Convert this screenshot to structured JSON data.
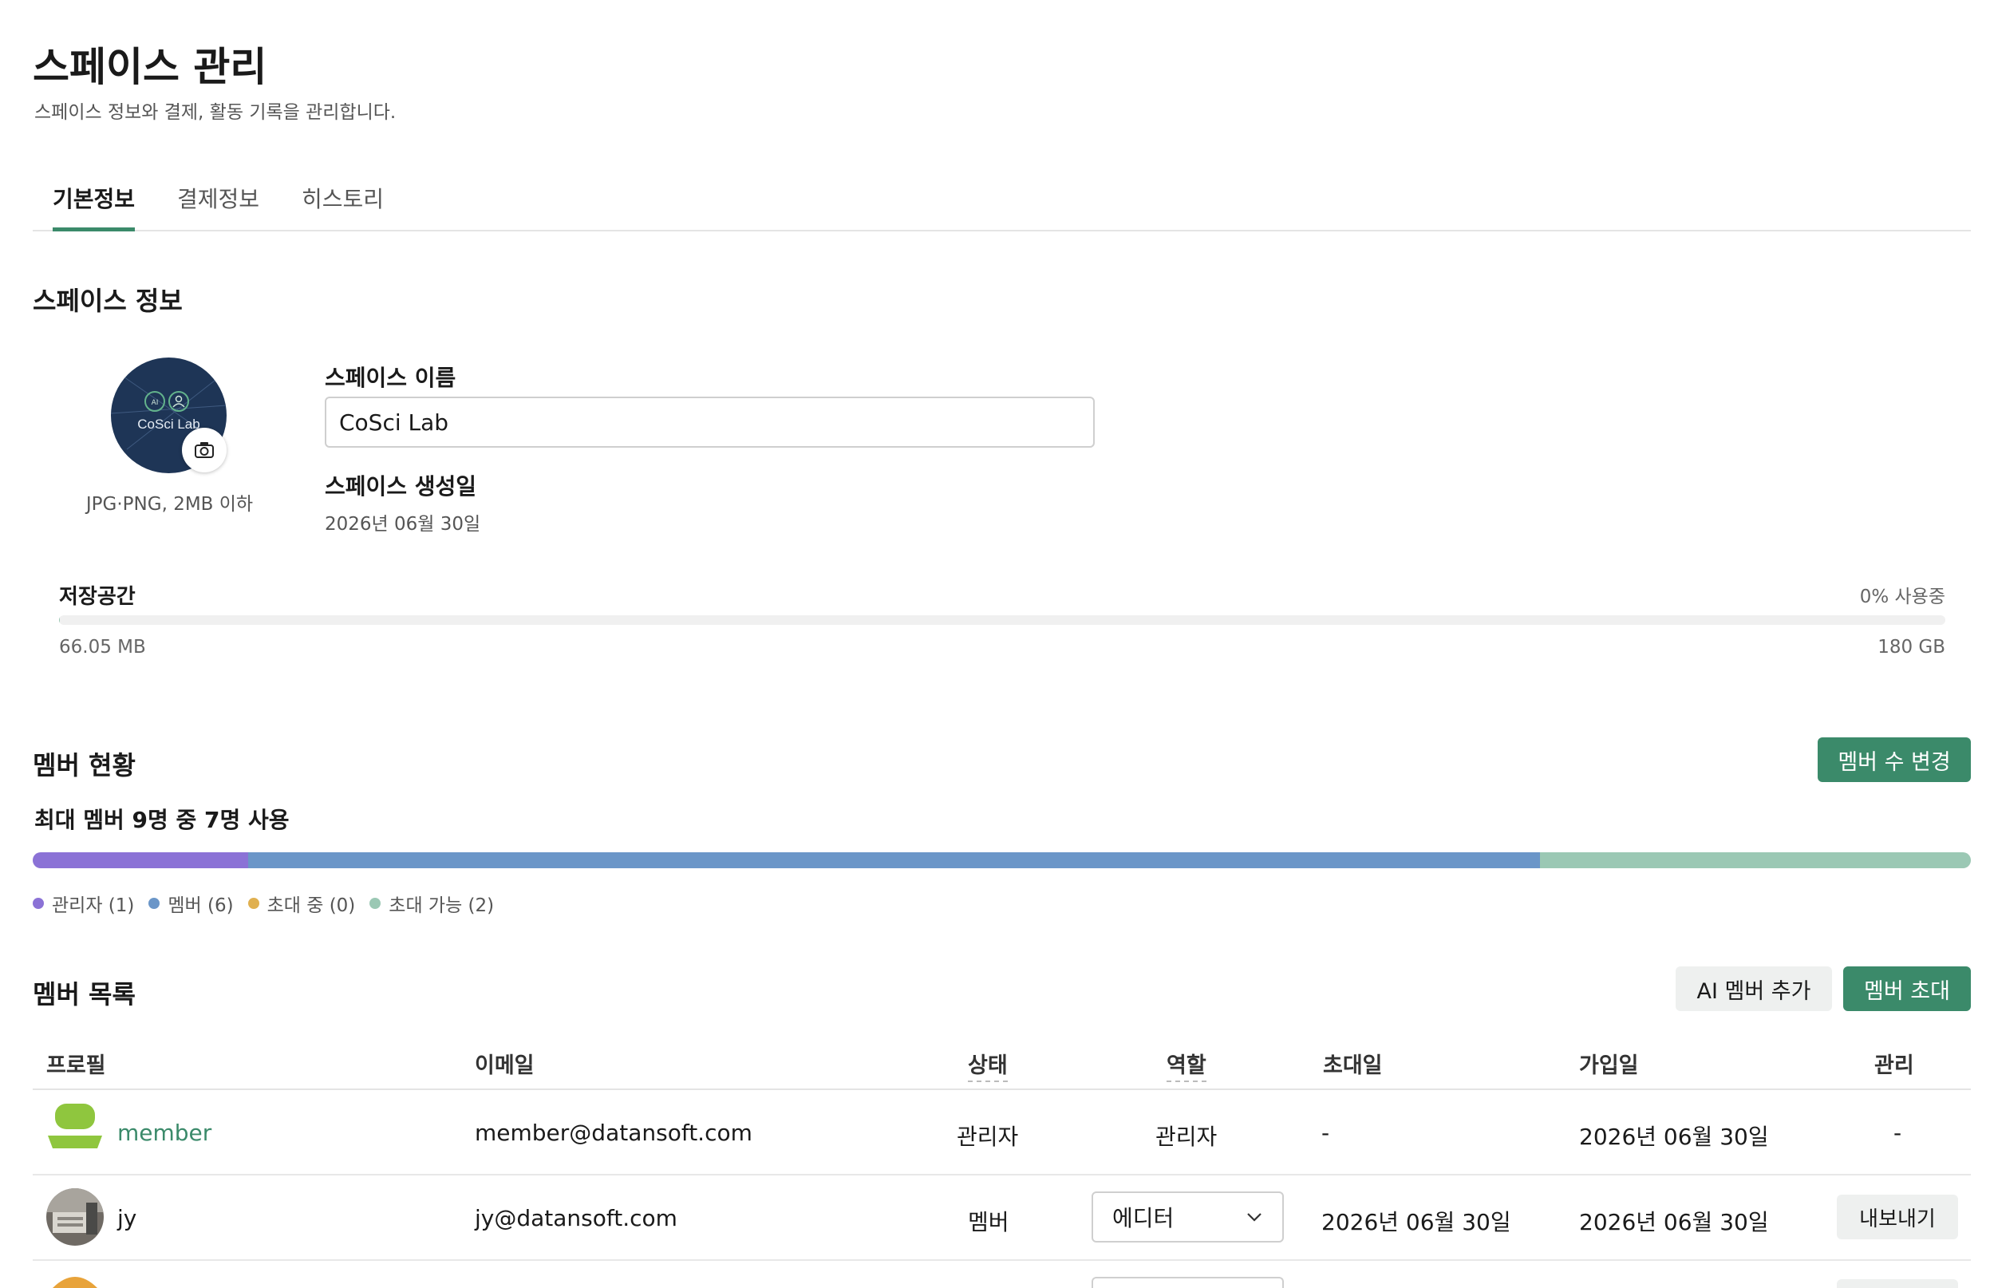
{
  "header": {
    "title": "스페이스 관리",
    "subtitle": "스페이스 정보와 결제, 활동 기록을 관리합니다."
  },
  "tabs": [
    {
      "label": "기본정보",
      "active": true
    },
    {
      "label": "결제정보",
      "active": false
    },
    {
      "label": "히스토리",
      "active": false
    }
  ],
  "space_info": {
    "section_title": "스페이스 정보",
    "avatar_text": "CoSci Lab",
    "avatar_icons": [
      "ai-icon",
      "user-icon"
    ],
    "upload_hint": "JPG·PNG, 2MB 이하",
    "name_label": "스페이스 이름",
    "name_value": "CoSci Lab",
    "created_label": "스페이스 생성일",
    "created_value": "2026년 06월 30일"
  },
  "storage": {
    "label": "저장공간",
    "usage_text": "0% 사용중",
    "usage_percent": 0.04,
    "used": "66.05 MB",
    "total": "180 GB"
  },
  "member_status": {
    "section_title": "멤버 현황",
    "change_button": "멤버 수 변경",
    "summary": "최대 멤버 9명 중 7명 사용",
    "max_members": 9,
    "segments": [
      {
        "label": "관리자 (1)",
        "count": 1,
        "color": "#8b72d6"
      },
      {
        "label": "멤버 (6)",
        "count": 6,
        "color": "#6b96c8"
      },
      {
        "label": "초대 중 (0)",
        "count": 0,
        "color": "#e0b050"
      },
      {
        "label": "초대 가능 (2)",
        "count": 2,
        "color": "#9bc8b4"
      }
    ]
  },
  "member_list": {
    "section_title": "멤버 목록",
    "ai_add_button": "AI 멤버 추가",
    "invite_button": "멤버 초대",
    "columns": [
      "프로필",
      "이메일",
      "상태",
      "역할",
      "초대일",
      "가입일",
      "관리"
    ],
    "rows": [
      {
        "name": "member",
        "email": "member@datansoft.com",
        "status": "관리자",
        "role": "관리자",
        "invited": "-",
        "joined": "2026년 06월 30일",
        "manage": "-"
      },
      {
        "name": "jy",
        "email": "jy@datansoft.com",
        "status": "멤버",
        "role": "에디터",
        "invited": "2026년 06월 30일",
        "joined": "2026년 06월 30일",
        "manage": "내보내기"
      }
    ]
  },
  "colors": {
    "accent": "#3b8a6a",
    "text": "#1a1a1a",
    "muted": "#555555"
  }
}
